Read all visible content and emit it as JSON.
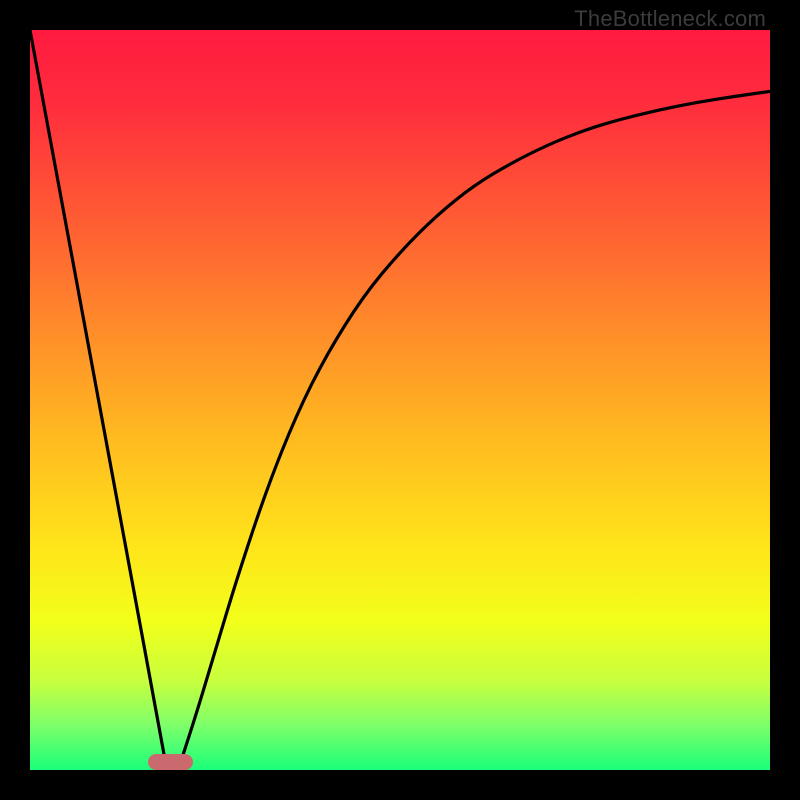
{
  "watermark": "TheBottleneck.com",
  "colors": {
    "black": "#000000",
    "curve": "#000000",
    "marker": "#cb6a6e",
    "gradient_stops": [
      {
        "offset": 0.0,
        "color": "#ff1a3f"
      },
      {
        "offset": 0.1,
        "color": "#ff2d3d"
      },
      {
        "offset": 0.25,
        "color": "#ff5a34"
      },
      {
        "offset": 0.4,
        "color": "#ff8a2a"
      },
      {
        "offset": 0.55,
        "color": "#ffba20"
      },
      {
        "offset": 0.7,
        "color": "#ffe51a"
      },
      {
        "offset": 0.8,
        "color": "#f2ff1a"
      },
      {
        "offset": 0.88,
        "color": "#c7ff3e"
      },
      {
        "offset": 0.94,
        "color": "#7dff6a"
      },
      {
        "offset": 1.0,
        "color": "#1aff7a"
      }
    ]
  },
  "chart_data": {
    "type": "line",
    "title": "",
    "xlabel": "",
    "ylabel": "",
    "xlim": [
      0,
      100
    ],
    "ylim": [
      0,
      100
    ],
    "legend": false,
    "grid": false,
    "annotations": [
      {
        "text": "TheBottleneck.com",
        "pos": "top-right"
      }
    ],
    "marker": {
      "x_start": 16,
      "x_end": 22,
      "y": 0.5,
      "color": "#cb6a6e"
    },
    "series": [
      {
        "name": "left-descent",
        "x": [
          0,
          5,
          10,
          15,
          18.5
        ],
        "values": [
          100,
          73,
          46,
          19,
          0
        ]
      },
      {
        "name": "right-curve",
        "x": [
          20,
          22,
          25,
          28,
          32,
          36,
          40,
          45,
          50,
          55,
          60,
          65,
          70,
          75,
          80,
          85,
          90,
          95,
          100
        ],
        "values": [
          0,
          6,
          16,
          26,
          38,
          48,
          56,
          64,
          70,
          75,
          79,
          82,
          84.5,
          86.5,
          88,
          89.2,
          90.2,
          91,
          91.7
        ]
      }
    ]
  }
}
